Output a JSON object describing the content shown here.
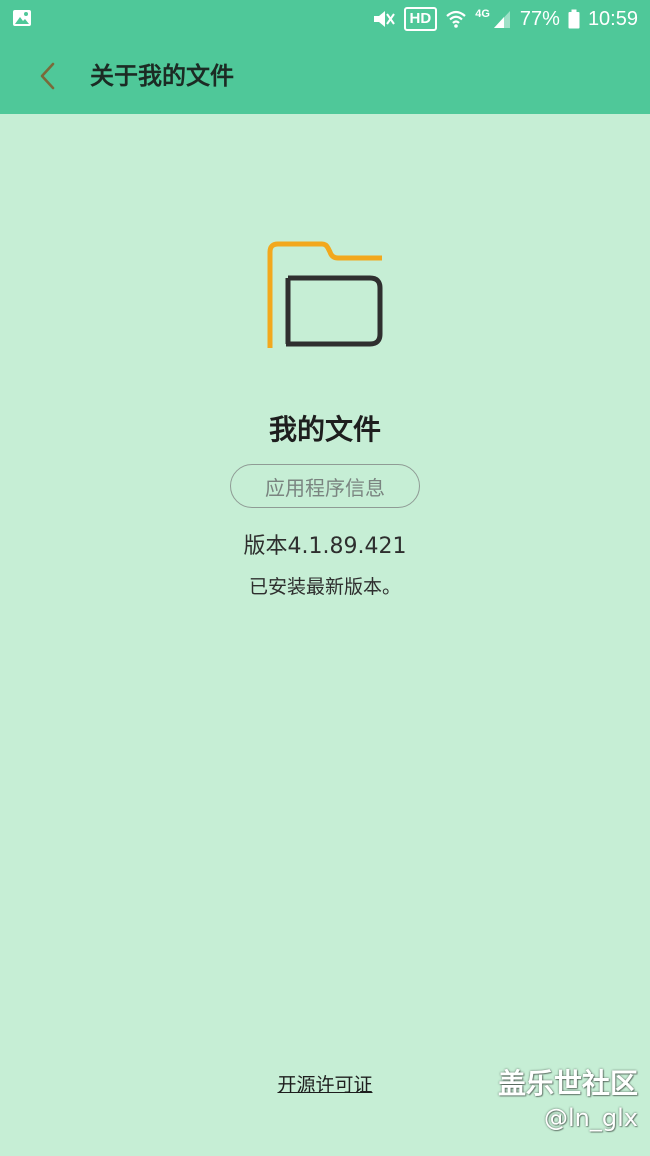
{
  "status_bar": {
    "hd_badge": "HD",
    "network_type": "4G",
    "battery": "77%",
    "time": "10:59",
    "icons": [
      "image-icon",
      "mute-icon",
      "wifi-icon",
      "signal-icon",
      "battery-icon"
    ]
  },
  "app_bar": {
    "back_icon": "chevron-left-icon",
    "title": "关于我的文件"
  },
  "about": {
    "app_icon": "folder-icon",
    "app_name": "我的文件",
    "app_info_button": "应用程序信息",
    "version": "版本4.1.89.421",
    "update_status": "已安装最新版本。"
  },
  "footer": {
    "license_link": "开源许可证"
  },
  "watermark": {
    "community": "盖乐世社区",
    "user": "@ln_glx"
  },
  "colors": {
    "header": "#4fc899",
    "background": "#c6eed5",
    "folder_accent": "#f2a81d",
    "folder_dark": "#2f2f2f",
    "back_arrow": "#7a6a3a"
  }
}
